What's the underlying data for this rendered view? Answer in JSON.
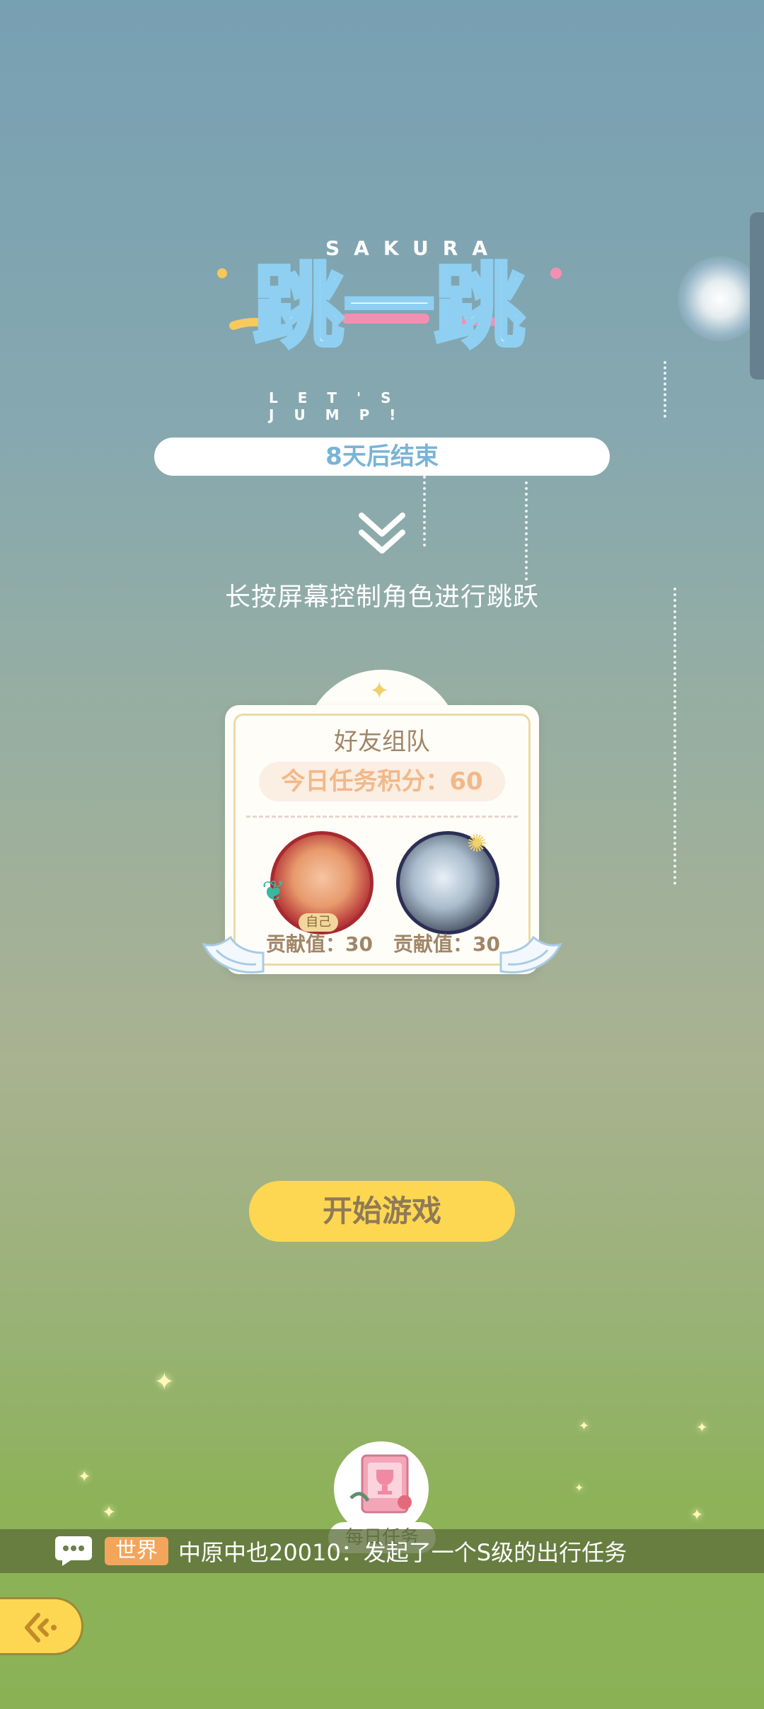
{
  "logo": {
    "top_text": "SAKURA",
    "title": "跳一跳",
    "subtitle": "LET'S JUMP!"
  },
  "countdown": "8天后结束",
  "instruction": "长按屏幕控制角色进行跳跃",
  "team_card": {
    "title": "好友组队",
    "daily_score": "今日任务积分：60",
    "members": [
      {
        "tag": "自己",
        "contribution": "贡献值：30"
      },
      {
        "contribution": "贡献值：30"
      }
    ]
  },
  "start_button": "开始游戏",
  "daily_tasks": "每日任务",
  "chat": {
    "channel": "世界",
    "message": "中原中也20010：发起了一个S级的出行任务"
  },
  "colors": {
    "start_button": "#fdd752",
    "countdown_text": "#79b4d6",
    "score_text": "#f2b88a",
    "world_tag": "#f3a55c"
  }
}
